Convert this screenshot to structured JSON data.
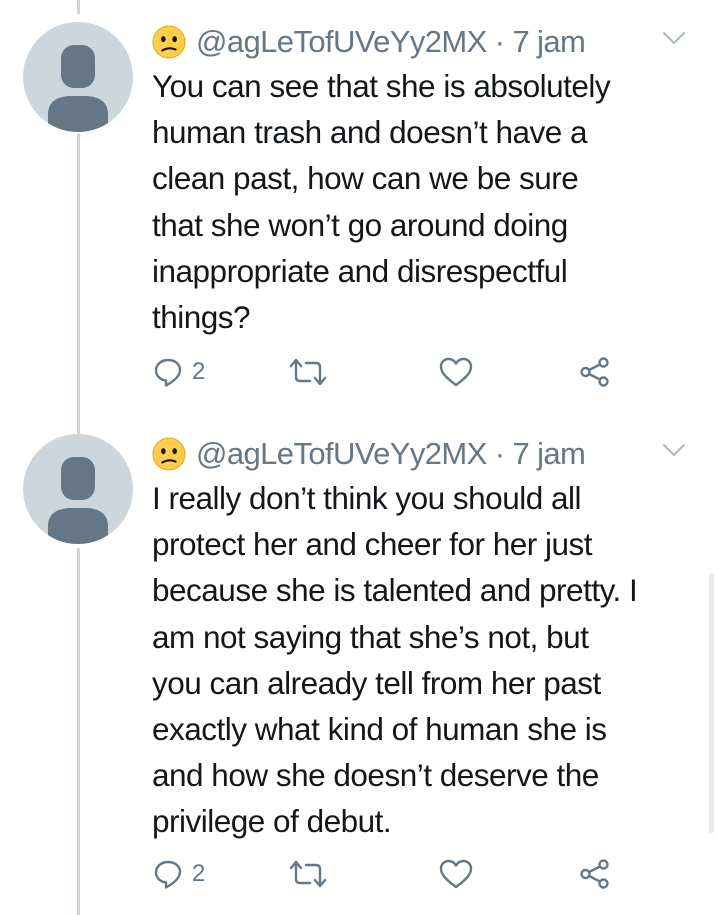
{
  "tweets": [
    {
      "handle": "@agLeTofUVeYy2MX",
      "separator": " · ",
      "time": "7 jam",
      "text": "You can see that she is absolutely\nhuman trash and doesn’t have a\nclean  past, how can we be sure\nthat she won’t go around doing\ninappropriate and disrespectful\nthings?",
      "reply_count": "2",
      "avatar_icon": "default-avatar-icon",
      "emoji_icon": "confused-face-emoji"
    },
    {
      "handle": "@agLeTofUVeYy2MX",
      "separator": " · ",
      "time": "7 jam",
      "text": "I really don’t think you should all\nprotect her and cheer for her just\nbecause she is talented and pretty. I\nam not saying that she’s not, but\nyou can already tell from her past\nexactly what kind of human she is\nand how she doesn’t deserve the\nprivilege of debut.",
      "reply_count": "2",
      "avatar_icon": "default-avatar-icon",
      "emoji_icon": "confused-face-emoji"
    }
  ],
  "actions": {
    "reply_icon": "reply-icon",
    "retweet_icon": "retweet-icon",
    "like_icon": "heart-icon",
    "share_icon": "share-icon"
  },
  "colors": {
    "text": "#14171a",
    "secondary": "#657786",
    "avatar_bg": "#ccd6dd",
    "avatar_fg": "#657786",
    "thread_line": "#ccd6dd",
    "emoji_face": "#ffcc4d"
  }
}
